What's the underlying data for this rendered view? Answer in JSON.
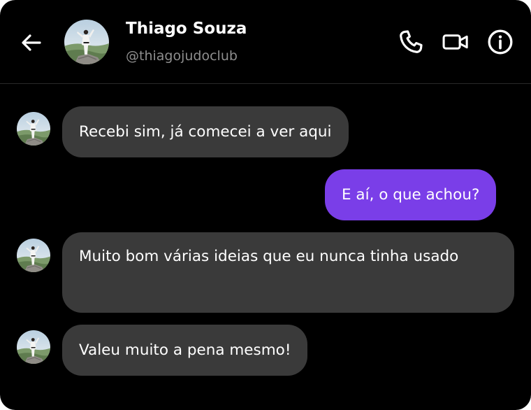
{
  "header": {
    "contact_name": "Thiago Souza",
    "contact_handle": "@thiagojudoclub",
    "icons": [
      "back-arrow-icon",
      "phone-icon",
      "video-camera-icon",
      "info-icon"
    ]
  },
  "messages": [
    {
      "sender": "contact",
      "text": "Recebi sim, já comecei a ver aqui"
    },
    {
      "sender": "me",
      "text": "E aí, o que achou?"
    },
    {
      "sender": "contact",
      "text": "Muito bom várias ideias que eu nunca tinha usado"
    },
    {
      "sender": "contact",
      "text": "Valeu muito a pena mesmo!"
    }
  ],
  "colors": {
    "background": "#000000",
    "incoming_bubble": "#3a3a3a",
    "outgoing_bubble": "#7a3ee8",
    "handle_text": "#8e8e8e"
  }
}
